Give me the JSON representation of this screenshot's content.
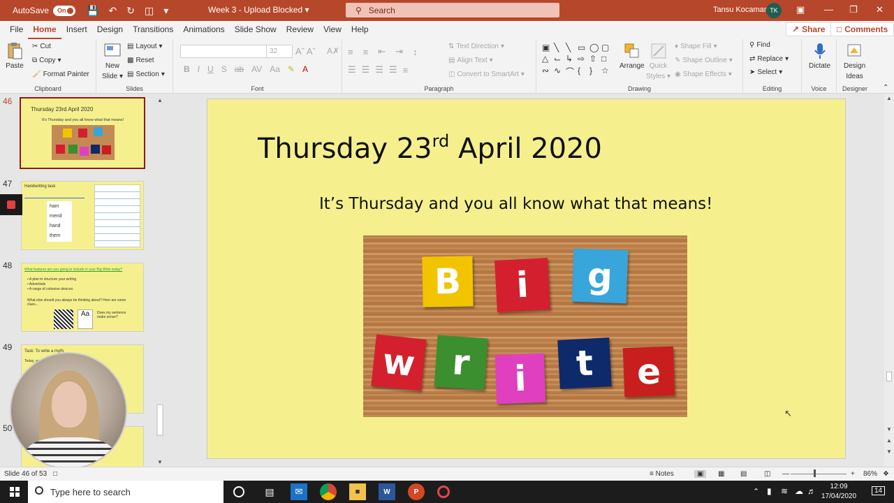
{
  "titlebar": {
    "autosave_label": "AutoSave",
    "autosave_state": "On",
    "doc_title": "Week 3  -  Upload Blocked",
    "search_placeholder": "Search",
    "user_name": "Tansu Kocaman",
    "user_initials": "TK"
  },
  "tabs": [
    "File",
    "Home",
    "Insert",
    "Design",
    "Transitions",
    "Animations",
    "Slide Show",
    "Review",
    "View",
    "Help"
  ],
  "active_tab": "Home",
  "share_label": "Share",
  "comments_label": "Comments",
  "ribbon": {
    "clipboard": {
      "paste": "Paste",
      "cut": "Cut",
      "copy": "Copy",
      "format_painter": "Format Painter",
      "label": "Clipboard"
    },
    "slides": {
      "new_slide_1": "New",
      "new_slide_2": "Slide",
      "layout": "Layout",
      "reset": "Reset",
      "section": "Section",
      "label": "Slides"
    },
    "font": {
      "size": "32",
      "label": "Font"
    },
    "paragraph": {
      "text_direction": "Text Direction",
      "align_text": "Align Text",
      "convert": "Convert to SmartArt",
      "label": "Paragraph"
    },
    "drawing": {
      "arrange": "Arrange",
      "quick_styles_1": "Quick",
      "quick_styles_2": "Styles",
      "shape_fill": "Shape Fill",
      "shape_outline": "Shape Outline",
      "shape_effects": "Shape Effects",
      "label": "Drawing"
    },
    "editing": {
      "find": "Find",
      "replace": "Replace",
      "select": "Select",
      "label": "Editing"
    },
    "voice": {
      "dictate": "Dictate",
      "label": "Voice"
    },
    "designer": {
      "design_ideas_1": "Design",
      "design_ideas_2": "Ideas",
      "label": "Designer"
    }
  },
  "thumbnails": [
    {
      "num": "46",
      "title": "Thursday 23rd April 2020",
      "sub": "It's Thursday and you all know what that means!"
    },
    {
      "num": "47",
      "title": "Handwriting task",
      "words": [
        "ham",
        "mend",
        "hand",
        "them"
      ]
    },
    {
      "num": "48",
      "title": "What features are you going to include in your Big Write today?",
      "bullets": [
        "A plan to structure your writing",
        "Adverbials",
        "A range of cohesive devices."
      ],
      "question": "What else should you always be thinking about? Here are some clues...",
      "badge": "Does my sentence make sense?"
    },
    {
      "num": "49",
      "title": "Task: To write a myth.",
      "sub": "Today, you"
    },
    {
      "num": "50"
    }
  ],
  "slide": {
    "title_main": "Thursday 23",
    "title_sup": "rd",
    "title_end": " April 2020",
    "subtitle": "It’s Thursday and you all know what that means!",
    "tiles_top": [
      "B",
      "i",
      "g"
    ],
    "tiles_bottom": [
      "w",
      "r",
      "i",
      "t",
      "e"
    ]
  },
  "status": {
    "slide_count": "Slide 46 of 53",
    "notes": "Notes",
    "zoom": "86%"
  },
  "taskbar": {
    "search_placeholder": "Type here to search",
    "time": "12:09",
    "date": "17/04/2020",
    "notification_count": "14"
  },
  "colors": {
    "accent": "#b7472a",
    "slide_bg": "#f5f08d",
    "tile_B": "#f2c400",
    "tile_i": "#d4202e",
    "tile_g": "#38a5db",
    "tile_w": "#d4202e",
    "tile_r": "#3b8f2e",
    "tile_i2": "#e040c0",
    "tile_t": "#0f2a6a",
    "tile_e": "#c81e1e"
  }
}
